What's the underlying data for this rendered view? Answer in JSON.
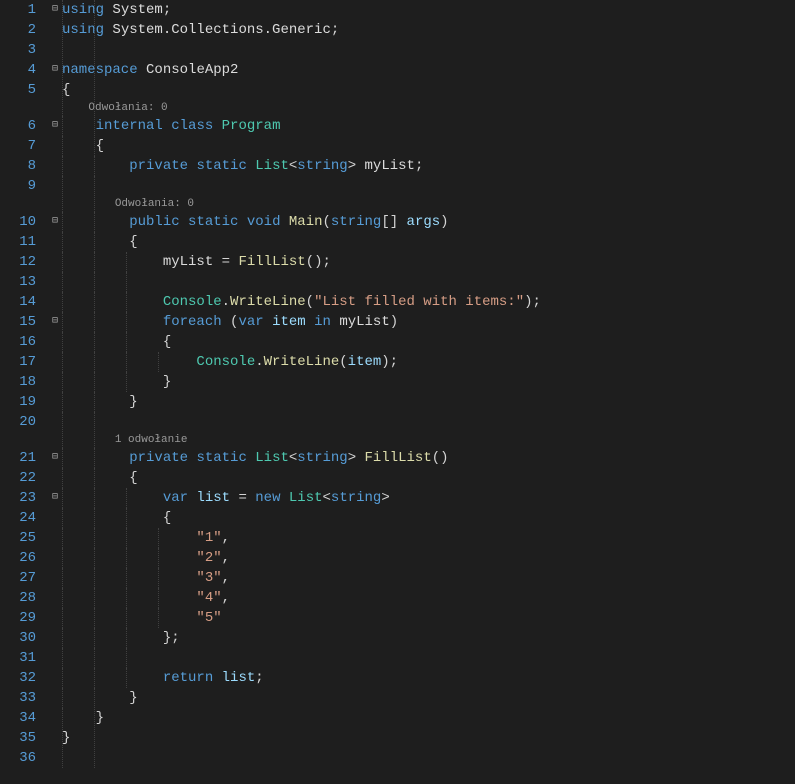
{
  "codelens": {
    "refs0_a": "Odwołania: 0",
    "refs0_b": "Odwołania: 0",
    "refs1": "1 odwołanie"
  },
  "fold": {
    "minus": "⊟"
  },
  "code": {
    "l1_using": "using",
    "l1_System": "System",
    "l1_semi": ";",
    "l2_using": "using",
    "l2_ns": "System.Collections.Generic",
    "l2_semi": ";",
    "l4_namespace": "namespace",
    "l4_name": "ConsoleApp2",
    "l5_brace": "{",
    "l6_internal": "internal",
    "l6_class": "class",
    "l6_Program": "Program",
    "l7_brace": "{",
    "l8_private": "private",
    "l8_static": "static",
    "l8_List": "List",
    "l8_lt": "<",
    "l8_string": "string",
    "l8_gt": ">",
    "l8_myList": "myList",
    "l8_semi": ";",
    "l10_public": "public",
    "l10_static": "static",
    "l10_void": "void",
    "l10_Main": "Main",
    "l10_op": "(",
    "l10_string": "string",
    "l10_arr": "[]",
    "l10_args": "args",
    "l10_cp": ")",
    "l11_brace": "{",
    "l12_myList": "myList",
    "l12_eq": " = ",
    "l12_Fill": "FillList",
    "l12_call": "();",
    "l14_Console": "Console",
    "l14_dot": ".",
    "l14_WriteLine": "WriteLine",
    "l14_op": "(",
    "l14_str": "\"List filled with items:\"",
    "l14_cp": ");",
    "l15_foreach": "foreach",
    "l15_op": " (",
    "l15_var": "var",
    "l15_sp": " ",
    "l15_item": "item",
    "l15_in": "in",
    "l15_myList": "myList",
    "l15_cp": ")",
    "l16_brace": "{",
    "l17_Console": "Console",
    "l17_dot": ".",
    "l17_WriteLine": "WriteLine",
    "l17_op": "(",
    "l17_item": "item",
    "l17_cp": ");",
    "l18_brace": "}",
    "l19_brace": "}",
    "l21_private": "private",
    "l21_static": "static",
    "l21_List": "List",
    "l21_lt": "<",
    "l21_string": "string",
    "l21_gt": ">",
    "l21_sp": " ",
    "l21_Fill": "FillList",
    "l21_call": "()",
    "l22_brace": "{",
    "l23_var": "var",
    "l23_list": "list",
    "l23_eq": " = ",
    "l23_new": "new",
    "l23_List": "List",
    "l23_lt": "<",
    "l23_string": "string",
    "l23_gt": ">",
    "l24_brace": "{",
    "l25": "\"1\"",
    "l25_c": ",",
    "l26": "\"2\"",
    "l26_c": ",",
    "l27": "\"3\"",
    "l27_c": ",",
    "l28": "\"4\"",
    "l28_c": ",",
    "l29": "\"5\"",
    "l30_brace": "};",
    "l32_return": "return",
    "l32_list": "list",
    "l32_semi": ";",
    "l33_brace": "}",
    "l34_brace": "}",
    "l35_brace": "}"
  },
  "linenums": {
    "n1": "1",
    "n2": "2",
    "n3": "3",
    "n4": "4",
    "n5": "5",
    "n6": "6",
    "n7": "7",
    "n8": "8",
    "n9": "9",
    "n10": "10",
    "n11": "11",
    "n12": "12",
    "n13": "13",
    "n14": "14",
    "n15": "15",
    "n16": "16",
    "n17": "17",
    "n18": "18",
    "n19": "19",
    "n20": "20",
    "n21": "21",
    "n22": "22",
    "n23": "23",
    "n24": "24",
    "n25": "25",
    "n26": "26",
    "n27": "27",
    "n28": "28",
    "n29": "29",
    "n30": "30",
    "n31": "31",
    "n32": "32",
    "n33": "33",
    "n34": "34",
    "n35": "35",
    "n36": "36"
  }
}
